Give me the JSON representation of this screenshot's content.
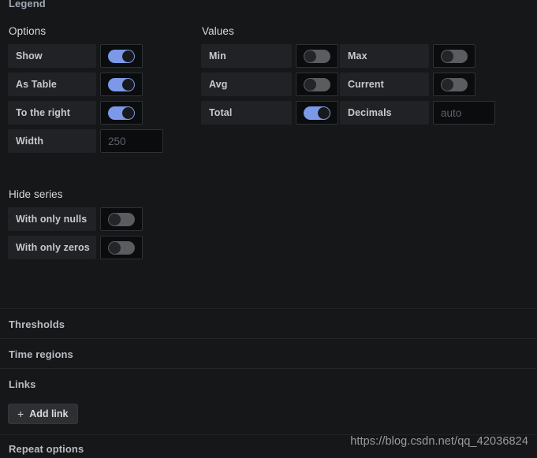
{
  "panel": {
    "section_title": "Legend"
  },
  "options_group": {
    "heading": "Options",
    "rows": [
      {
        "label": "Show",
        "control": "toggle",
        "value": true
      },
      {
        "label": "As Table",
        "control": "toggle",
        "value": true
      },
      {
        "label": "To the right",
        "control": "toggle",
        "value": true
      },
      {
        "label": "Width",
        "control": "input",
        "value": "",
        "placeholder": "250"
      }
    ]
  },
  "values_group": {
    "heading": "Values",
    "rows": [
      [
        {
          "label": "Min",
          "control": "toggle",
          "value": false
        },
        {
          "label": "Max",
          "control": "toggle",
          "value": false
        }
      ],
      [
        {
          "label": "Avg",
          "control": "toggle",
          "value": false
        },
        {
          "label": "Current",
          "control": "toggle",
          "value": false
        }
      ],
      [
        {
          "label": "Total",
          "control": "toggle",
          "value": true
        },
        {
          "label": "Decimals",
          "control": "input",
          "value": "",
          "placeholder": "auto"
        }
      ]
    ]
  },
  "hide_series_group": {
    "heading": "Hide series",
    "rows": [
      {
        "label": "With only nulls",
        "control": "toggle",
        "value": false
      },
      {
        "label": "With only zeros",
        "control": "toggle",
        "value": false
      }
    ]
  },
  "collapsed_sections": [
    {
      "title": "Thresholds"
    },
    {
      "title": "Time regions"
    },
    {
      "title": "Links"
    },
    {
      "title": "Repeat options"
    }
  ],
  "links_section": {
    "add_link_label": "Add link",
    "add_icon": "plus-icon"
  },
  "watermark": {
    "text": "https://blog.csdn.net/qq_42036824"
  },
  "colors": {
    "background": "#161719",
    "row_label_bg": "#202226",
    "control_bg": "#0b0c0e",
    "toggle_on": "#7b99e8",
    "toggle_off": "#5a5c60",
    "text": "#d8d9da",
    "muted_text": "#9fa7b3"
  }
}
